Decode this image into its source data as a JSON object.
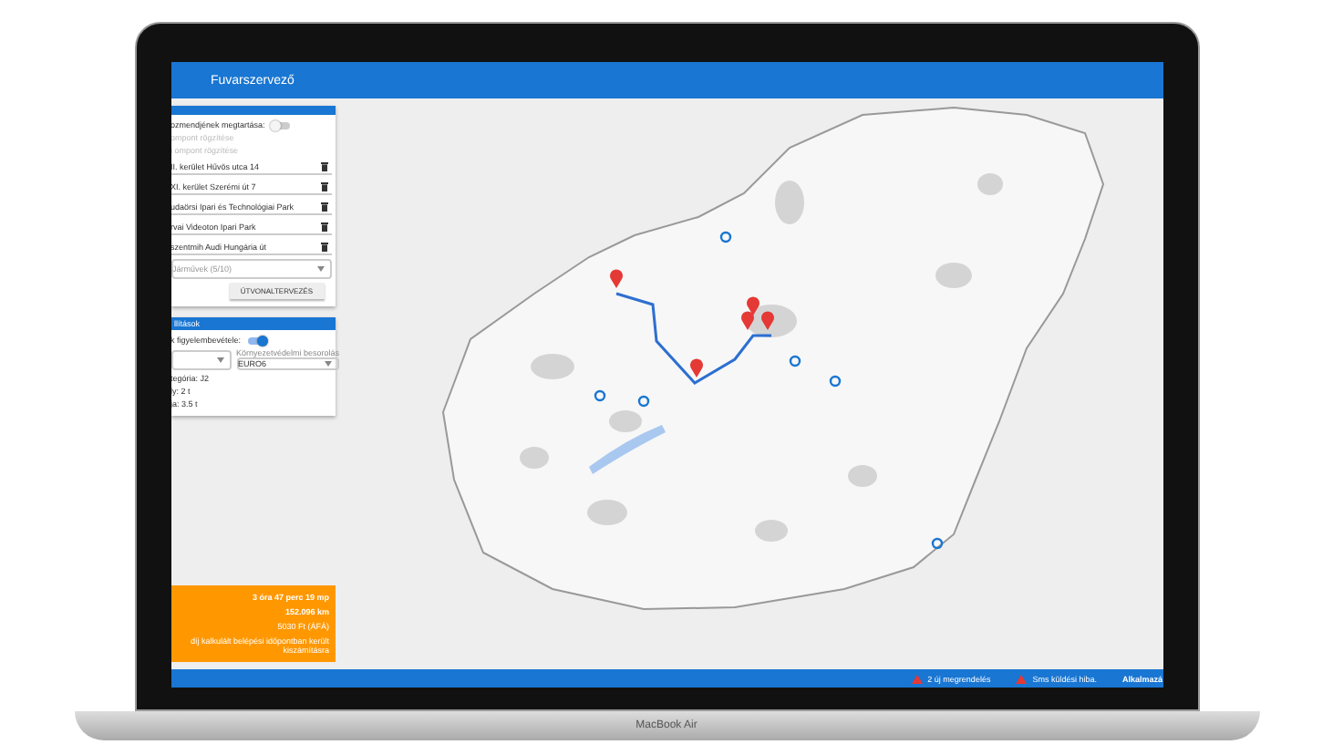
{
  "header": {
    "title": "Fuvarszervező"
  },
  "planner": {
    "keep_order": {
      "label": "ozmendjének megtartása:",
      "on": false
    },
    "fixed_points": [
      {
        "label": "ompont rögzítése",
        "disabled": true
      },
      {
        "label": "i ompont rögzítése",
        "disabled": true
      }
    ],
    "stops": [
      {
        "address": "II. kerület Hűvös utca 14"
      },
      {
        "address": "XI. kerület Szerémi út 7"
      },
      {
        "address": "udaörsi Ipari és Technológiai Park"
      },
      {
        "address": "rvai Videoton Ipari Park"
      },
      {
        "address": "szentmih Audi Hungária út"
      }
    ],
    "vehicle_select": {
      "value": "Járművek (5/10)"
    },
    "plan_button": "ÚTVONALTERVEZÉS"
  },
  "settings": {
    "title": "llítások",
    "toll_toggle": {
      "label": "k figyelembevétele:",
      "on": true
    },
    "emission_select": {
      "label": "Környezetvédelmi besorolás",
      "value": "EURO6"
    },
    "vehicle_info": [
      "tegória: J2",
      "ly: 2 t",
      "ja: 3.5 t"
    ]
  },
  "summary": {
    "duration": "3 óra 47 perc 19 mp",
    "distance": "152.096 km",
    "cost": "5030 Ft (ÁFÁ)",
    "note": "díj kalkulált belépési időpontban került kiszámításra"
  },
  "status_bar": {
    "alerts": [
      {
        "text": "2 új megrendelés"
      },
      {
        "text": "Sms küldési hiba."
      }
    ],
    "app_label": "Alkalmazá"
  },
  "laptop": {
    "label": "MacBook Air"
  }
}
